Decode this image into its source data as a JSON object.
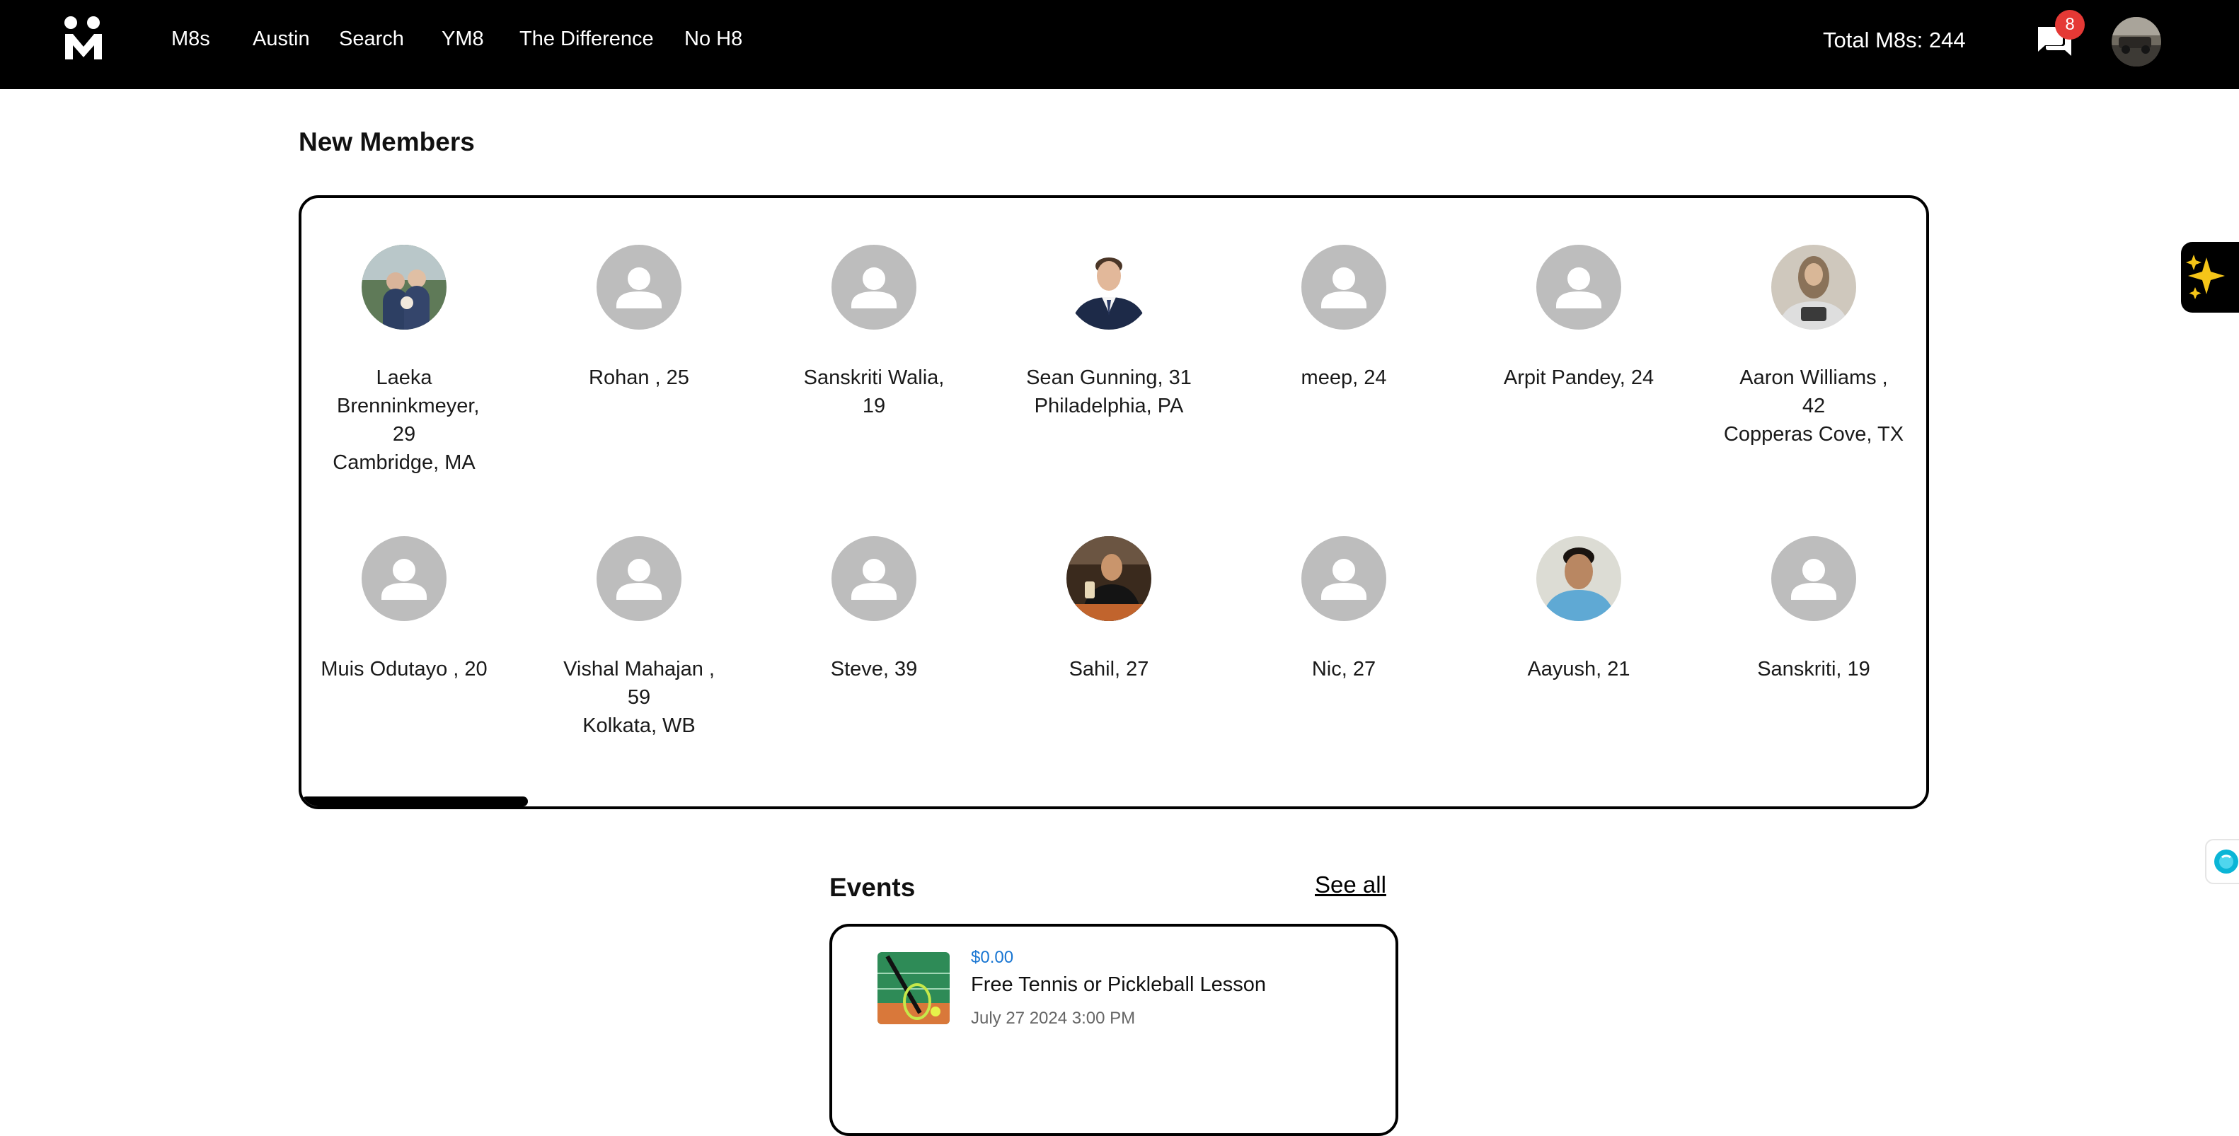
{
  "nav": {
    "links": [
      "M8s",
      "Austin",
      "Search",
      "YM8",
      "The Difference",
      "No H8"
    ],
    "total_label": "Total M8s: 244",
    "message_count": "8",
    "chat_icon": "chat-bubbles-icon",
    "logo_icon": "m8s-logo-icon"
  },
  "members": {
    "title": "New Members",
    "items": [
      {
        "name": "Laeka Brenninkmeyer, 29",
        "location": "Cambridge, MA",
        "photo": true
      },
      {
        "name": "Rohan , 25",
        "location": "",
        "photo": false
      },
      {
        "name": "Sanskriti Walia, 19",
        "location": "",
        "photo": false
      },
      {
        "name": "Sean Gunning, 31",
        "location": "Philadelphia, PA",
        "photo": true
      },
      {
        "name": "meep, 24",
        "location": "",
        "photo": false
      },
      {
        "name": "Arpit Pandey, 24",
        "location": "",
        "photo": false
      },
      {
        "name": "Aaron Williams , 42",
        "location": "Copperas Cove, TX",
        "photo": true
      },
      {
        "name": "Muis Odutayo , 20",
        "location": "",
        "photo": false
      },
      {
        "name": "Vishal Mahajan , 59",
        "location": "Kolkata, WB",
        "photo": false
      },
      {
        "name": "Steve, 39",
        "location": "",
        "photo": false
      },
      {
        "name": "Sahil, 27",
        "location": "",
        "photo": true
      },
      {
        "name": "Nic, 27",
        "location": "",
        "photo": false
      },
      {
        "name": "Aayush, 21",
        "location": "",
        "photo": true
      },
      {
        "name": "Sanskriti, 19",
        "location": "",
        "photo": false
      }
    ]
  },
  "events": {
    "title": "Events",
    "see_all": "See all",
    "items": [
      {
        "price": "$0.00",
        "title": "Free Tennis or Pickleball Lesson",
        "date": "July 27 2024 3:00 PM"
      }
    ]
  },
  "colors": {
    "nav_bg": "#000000",
    "badge": "#e53935",
    "price": "#1976d2",
    "placeholder_avatar": "#bdbdbd"
  }
}
